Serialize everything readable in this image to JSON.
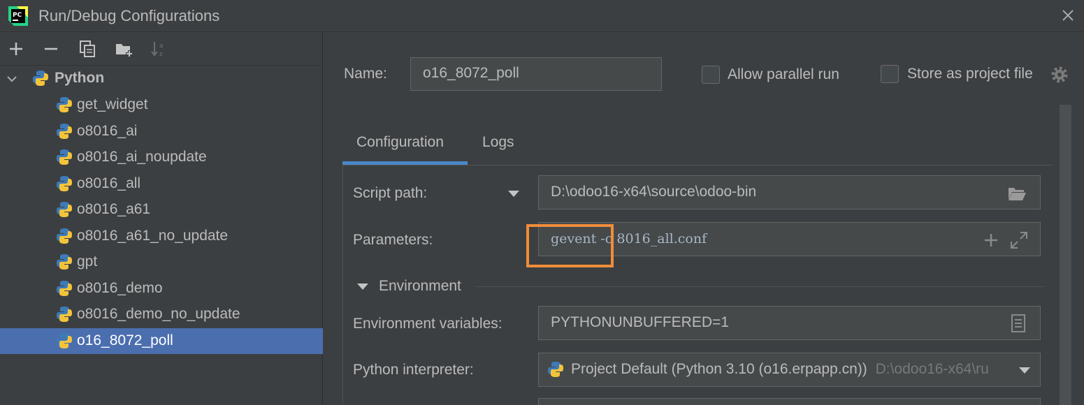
{
  "window": {
    "title": "Run/Debug Configurations",
    "app_icon": "pycharm-icon",
    "close_icon": "close-icon"
  },
  "toolbar": {
    "icons": [
      "add-icon",
      "remove-icon",
      "copy-icon",
      "new-folder-icon",
      "sort-icon"
    ]
  },
  "tree": {
    "group_label": "Python",
    "items": [
      {
        "label": "get_widget"
      },
      {
        "label": "o8016_ai"
      },
      {
        "label": "o8016_ai_noupdate"
      },
      {
        "label": "o8016_all"
      },
      {
        "label": "o8016_a61"
      },
      {
        "label": "o8016_a61_no_update"
      },
      {
        "label": "gpt"
      },
      {
        "label": "o8016_demo"
      },
      {
        "label": "o8016_demo_no_update"
      },
      {
        "label": "o16_8072_poll"
      }
    ],
    "selected": "o16_8072_poll"
  },
  "header": {
    "name_label": "Name:",
    "name_value": "o16_8072_poll",
    "allow_parallel_label": "Allow parallel run",
    "store_project_label": "Store as project file"
  },
  "tabs": [
    {
      "label": "Configuration"
    },
    {
      "label": "Logs"
    }
  ],
  "active_tab": "Configuration",
  "config": {
    "script_path_label": "Script path:",
    "script_path_value": "D:\\odoo16-x64\\source\\odoo-bin",
    "parameters_label": "Parameters:",
    "parameters_value": "gevent -c 8016_all.conf",
    "environment_section": "Environment",
    "env_vars_label": "Environment variables:",
    "env_vars_value": "PYTHONUNBUFFERED=1",
    "interpreter_label": "Python interpreter:",
    "interpreter_value": "Project Default (Python 3.10 (o16.erpapp.cn))",
    "interpreter_path": "D:\\odoo16-x64\\ru"
  },
  "colors": {
    "accent": "#4a88c7",
    "selection": "#4b6eaf",
    "highlight": "#f08c3a"
  }
}
